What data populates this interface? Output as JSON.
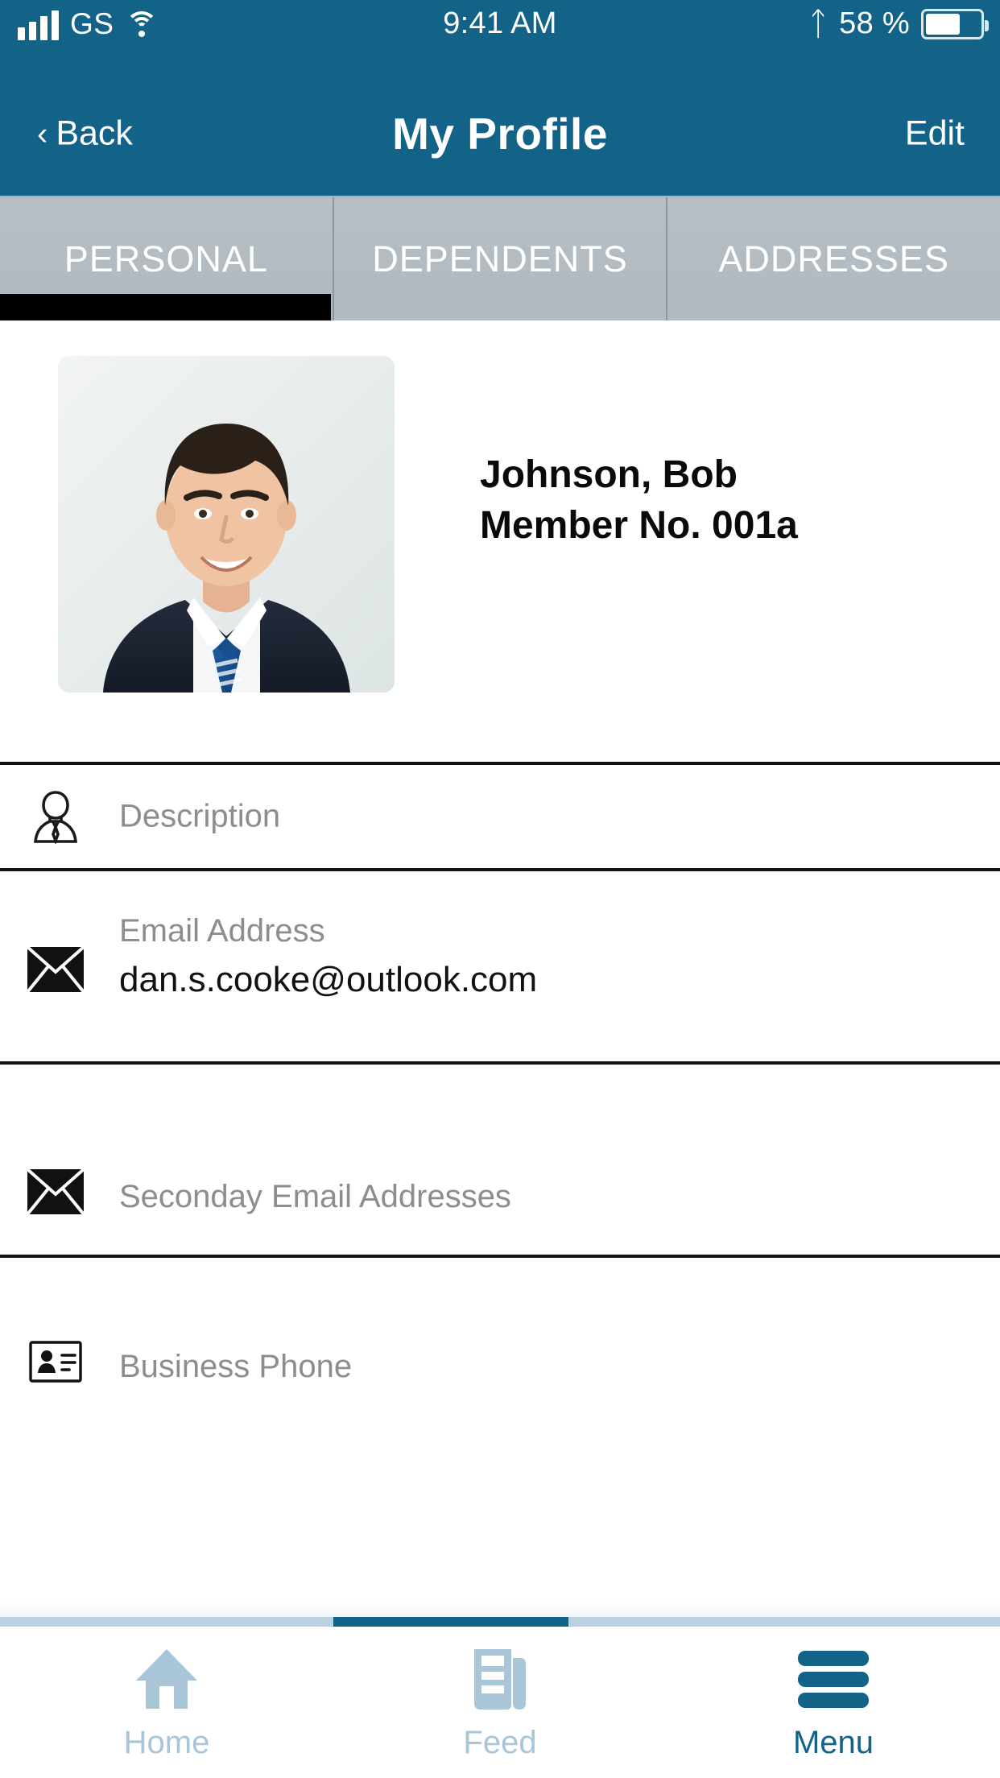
{
  "status_bar": {
    "carrier": "GS",
    "time": "9:41 AM",
    "battery_percent": "58 %",
    "signal_icon": "signal-bars-icon",
    "wifi_icon": "wifi-icon",
    "bluetooth_icon": "bluetooth-icon",
    "battery_icon": "battery-icon",
    "battery_level": 58
  },
  "nav_bar": {
    "back_label": "Back",
    "back_chevron": "‹",
    "title": "My Profile",
    "edit_label": "Edit",
    "background_color": "#136389"
  },
  "tabs": {
    "items": [
      {
        "label": "PERSONAL",
        "active": true
      },
      {
        "label": "DEPENDENTS",
        "active": false
      },
      {
        "label": "ADDRESSES",
        "active": false
      }
    ],
    "active_indicator_color": "#000000",
    "background_color": "#b4bdc3",
    "text_color": "#ffffff"
  },
  "profile": {
    "photo_alt": "profile-photo",
    "name": "Johnson, Bob",
    "member_no": "Member No. 001a"
  },
  "fields": [
    {
      "icon": "person-tie-icon",
      "label": "Description",
      "value": "",
      "has_value": false
    },
    {
      "icon": "envelope-icon",
      "label": "Email Address",
      "value": "dan.s.cooke@outlook.com",
      "has_value": true
    },
    {
      "icon": "envelope-icon",
      "label": "Seconday Email Addresses",
      "value": "",
      "has_value": false
    },
    {
      "icon": "contact-card-icon",
      "label": "Business Phone",
      "value": "",
      "has_value": false
    }
  ],
  "bottom_bar": {
    "items": [
      {
        "label": "Home",
        "icon": "home-icon",
        "active": false
      },
      {
        "label": "Feed",
        "icon": "newspaper-icon",
        "active": false
      },
      {
        "label": "Menu",
        "icon": "hamburger-menu-icon",
        "active": true
      }
    ],
    "active_color": "#136389",
    "inactive_color": "#a8c6d8"
  }
}
